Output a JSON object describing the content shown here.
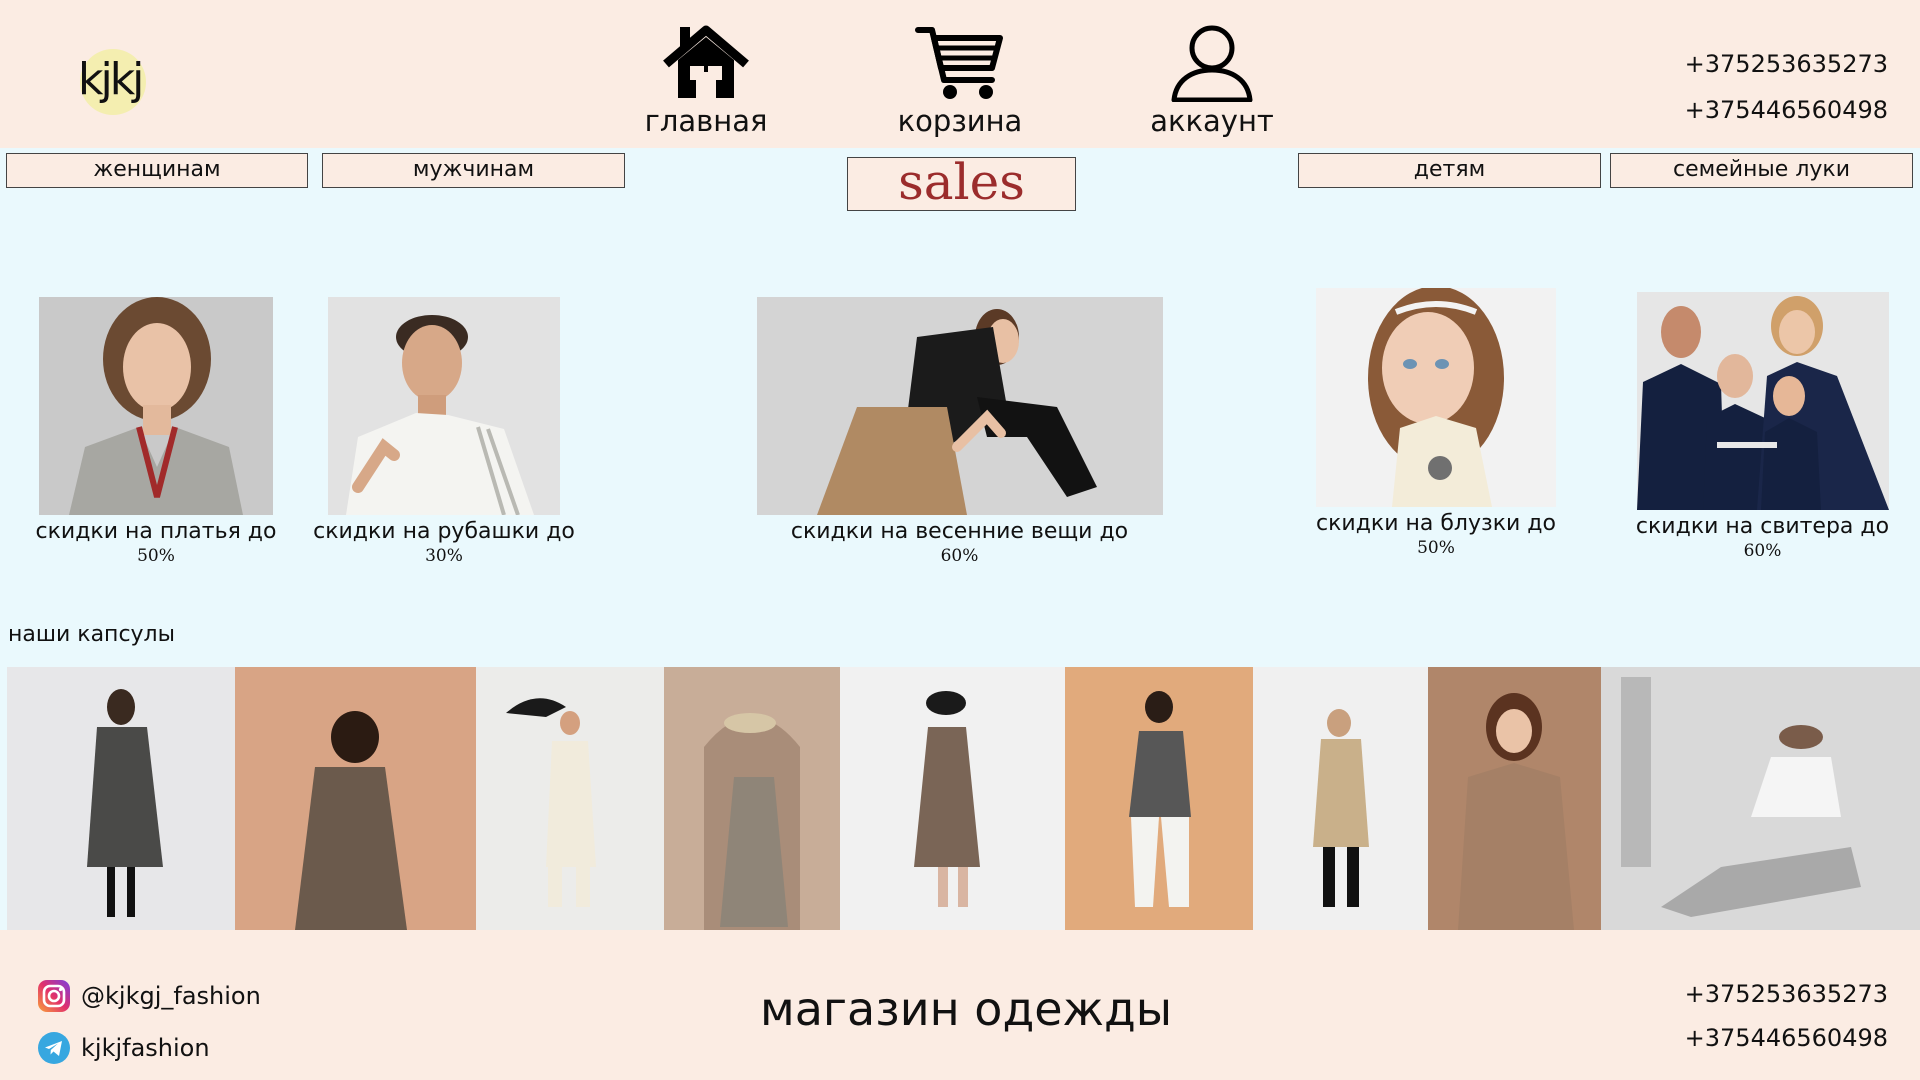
{
  "header": {
    "logo_text": "kjkj",
    "nav": [
      {
        "label": "главная",
        "icon": "home-icon"
      },
      {
        "label": "корзина",
        "icon": "cart-icon"
      },
      {
        "label": "аккаунт",
        "icon": "account-icon"
      }
    ],
    "phones": [
      "+375253635273",
      "+375446560498"
    ]
  },
  "categories": {
    "women": "женщинам",
    "men": "мужчинам",
    "sales": "sales",
    "kids": "детям",
    "family": "семейные луки"
  },
  "deals": [
    {
      "title": "скидки на платья до",
      "percent": "50%"
    },
    {
      "title": "скидки на рубашки до",
      "percent": "30%"
    },
    {
      "title": "скидки на весенние вещи до",
      "percent": "60%"
    },
    {
      "title": "скидки на блузки до",
      "percent": "50%"
    },
    {
      "title": "скидки на свитера до",
      "percent": "60%"
    }
  ],
  "capsules": {
    "title": "наши капсулы"
  },
  "footer": {
    "instagram": "@kjkgj_fashion",
    "telegram": "kjkjfashion",
    "title": "магазин одежды",
    "phones": [
      "+375253635273",
      "+375446560498"
    ]
  },
  "colors": {
    "header_bg": "#fbece3",
    "body_bg": "#eaf9fd",
    "sales_text": "#9b2c2c",
    "logo_circle": "#f4eeb0"
  }
}
